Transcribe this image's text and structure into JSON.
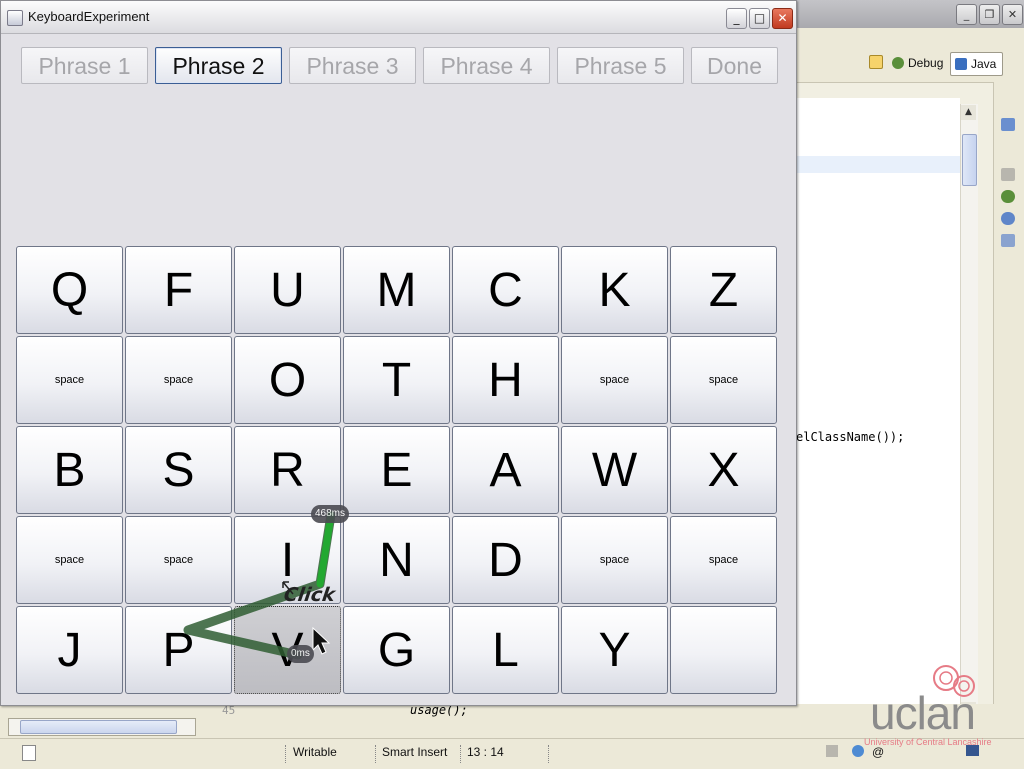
{
  "ide": {
    "perspectives": [
      {
        "label": "Debug"
      },
      {
        "label": "Java"
      }
    ],
    "code_fragment": "elClassName());",
    "code_usage": "usage();",
    "line_number": "45",
    "status": {
      "writable": "Writable",
      "insert_mode": "Smart Insert",
      "position": "13 : 14"
    }
  },
  "window": {
    "title": "KeyboardExperiment",
    "minimize_glyph": "_",
    "maximize_glyph": "□",
    "close_glyph": "✕"
  },
  "phrases": [
    {
      "label": "Phrase 1",
      "active": false
    },
    {
      "label": "Phrase 2",
      "active": true
    },
    {
      "label": "Phrase 3",
      "active": false
    },
    {
      "label": "Phrase 4",
      "active": false
    },
    {
      "label": "Phrase 5",
      "active": false
    },
    {
      "label": "Done",
      "active": false
    }
  ],
  "keyboard": {
    "rows": [
      [
        "Q",
        "F",
        "U",
        "M",
        "C",
        "K",
        "Z"
      ],
      [
        "space",
        "space",
        "O",
        "T",
        "H",
        "space",
        "space"
      ],
      [
        "B",
        "S",
        "R",
        "E",
        "A",
        "W",
        "X"
      ],
      [
        "space",
        "space",
        "I",
        "N",
        "D",
        "space",
        "space"
      ],
      [
        "J",
        "P",
        "V",
        "G",
        "L",
        "Y",
        ""
      ]
    ],
    "pressed_key": "V"
  },
  "overlay": {
    "click_label": "Click",
    "timings": [
      "468ms",
      "0ms"
    ],
    "colors": {
      "trail_dark": "#2f5d32",
      "trail_bright": "#1fae2e"
    }
  },
  "watermark": {
    "brand": "uclan",
    "tagline": "University of Central Lancashire",
    "color": "#e67b86"
  }
}
